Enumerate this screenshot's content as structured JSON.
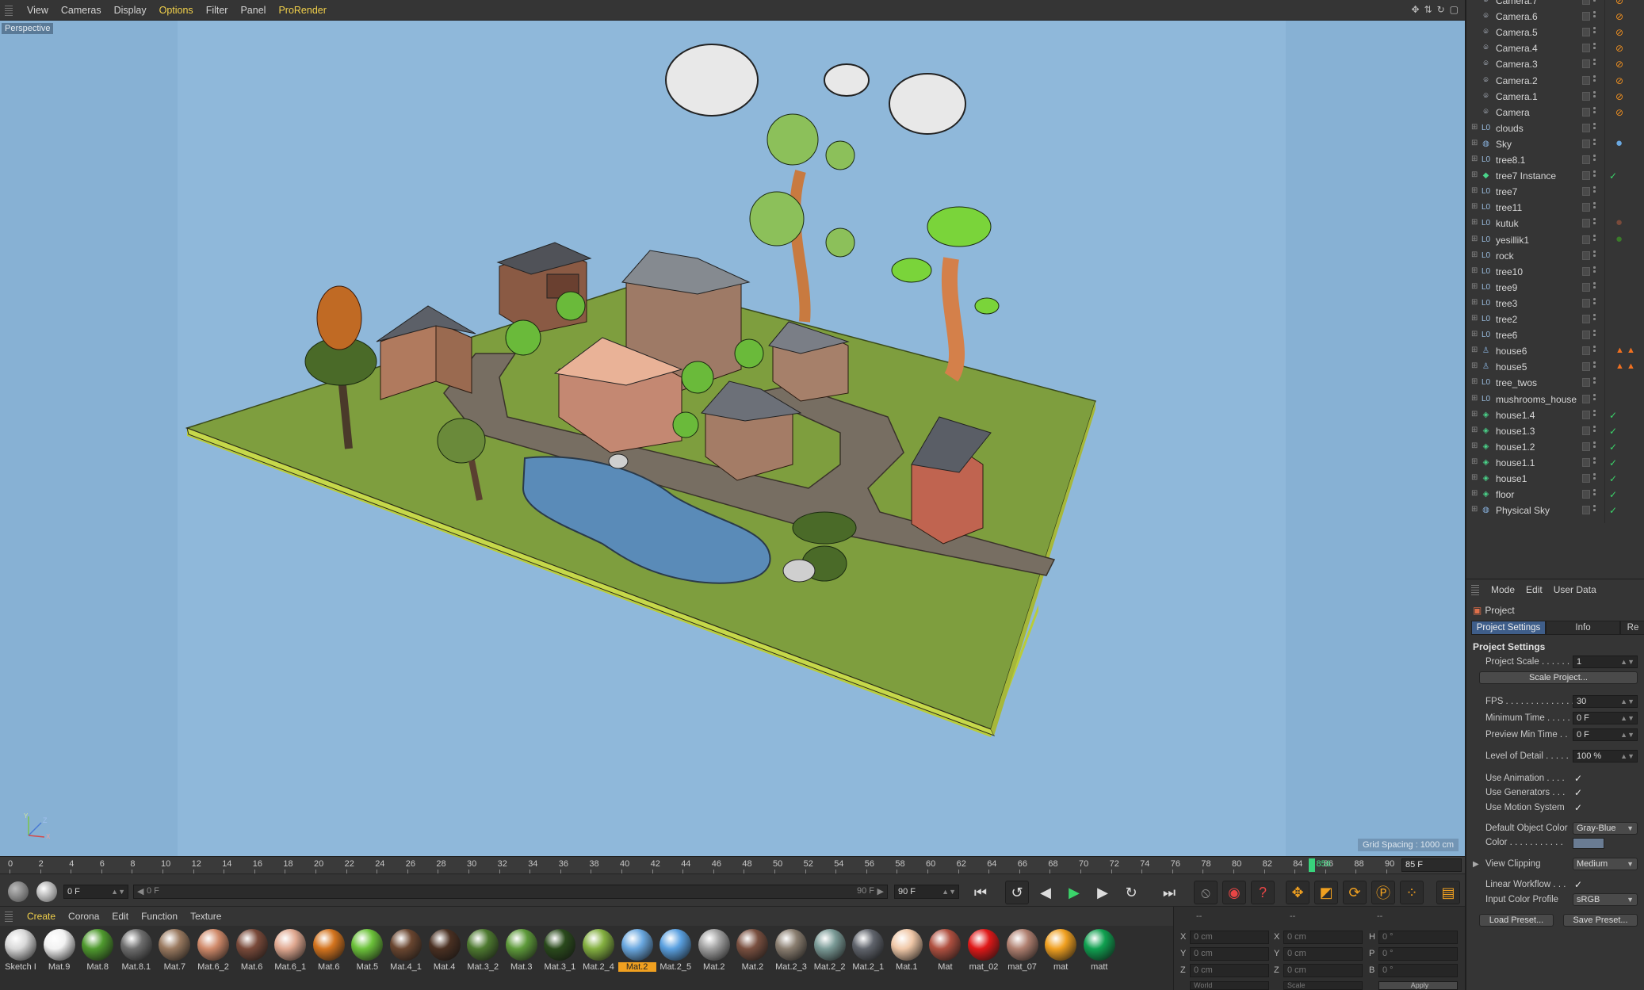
{
  "viewport": {
    "menu": [
      "View",
      "Cameras",
      "Display",
      "Options",
      "Filter",
      "Panel",
      "ProRender"
    ],
    "menu_highlight": [
      "Options",
      "ProRender"
    ],
    "label": "Perspective",
    "grid_spacing": "Grid Spacing : 1000 cm",
    "axis": {
      "y": "Y",
      "z": "Z",
      "x": "X"
    }
  },
  "timeline": {
    "ticks": [
      "0",
      "2",
      "4",
      "6",
      "8",
      "10",
      "12",
      "14",
      "16",
      "18",
      "20",
      "22",
      "24",
      "26",
      "28",
      "30",
      "32",
      "34",
      "36",
      "38",
      "40",
      "42",
      "44",
      "46",
      "48",
      "50",
      "52",
      "54",
      "56",
      "58",
      "60",
      "62",
      "64",
      "66",
      "68",
      "70",
      "72",
      "74",
      "76",
      "78",
      "80",
      "82",
      "84",
      "86",
      "88",
      "90"
    ],
    "current_label": "856",
    "end_field": "85 F"
  },
  "transport": {
    "current_frame": "0 F",
    "range_start": "0 F",
    "range_end": "90 F",
    "max_frame": "90 F"
  },
  "material_manager": {
    "menu": [
      "Create",
      "Corona",
      "Edit",
      "Function",
      "Texture"
    ],
    "active_menu": "Create",
    "materials": [
      {
        "name": "Sketch I",
        "color": "#d8d8d8"
      },
      {
        "name": "Mat.9",
        "color": "#f2f2f2"
      },
      {
        "name": "Mat.8",
        "color": "#4f9a2e"
      },
      {
        "name": "Mat.8.1",
        "color": "#6e6e6e"
      },
      {
        "name": "Mat.7",
        "color": "#9a7a60"
      },
      {
        "name": "Mat.6_2",
        "color": "#d08a6a"
      },
      {
        "name": "Mat.6",
        "color": "#7a4a3a"
      },
      {
        "name": "Mat.6_1",
        "color": "#e0a890"
      },
      {
        "name": "Mat.6",
        "color": "#d4741e"
      },
      {
        "name": "Mat.5",
        "color": "#6cc23a"
      },
      {
        "name": "Mat.4_1",
        "color": "#6a4630"
      },
      {
        "name": "Mat.4",
        "color": "#4a3022"
      },
      {
        "name": "Mat.3_2",
        "color": "#4e7a30"
      },
      {
        "name": "Mat.3",
        "color": "#5e9a3a"
      },
      {
        "name": "Mat.3_1",
        "color": "#2a4a1c"
      },
      {
        "name": "Mat.2_4",
        "color": "#84b040"
      },
      {
        "name": "Mat.2",
        "color": "#6aa8e0"
      },
      {
        "name": "Mat.2_5",
        "color": "#5aa0e0"
      },
      {
        "name": "Mat.2",
        "color": "#a0a0a0"
      },
      {
        "name": "Mat.2",
        "color": "#7a5040"
      },
      {
        "name": "Mat.2_3",
        "color": "#8a7e70"
      },
      {
        "name": "Mat.2_2",
        "color": "#7a9a96"
      },
      {
        "name": "Mat.2_1",
        "color": "#60646c"
      },
      {
        "name": "Mat.1",
        "color": "#f0c8a8"
      },
      {
        "name": "Mat",
        "color": "#b05040"
      },
      {
        "name": "mat_02",
        "color": "#e01818"
      },
      {
        "name": "mat_07",
        "color": "#b08070"
      },
      {
        "name": "mat",
        "color": "#f0a020"
      },
      {
        "name": "matt",
        "color": "#10a050"
      }
    ],
    "selected_index": 16
  },
  "coordinates": {
    "headers": [
      "--",
      "--",
      "--"
    ],
    "rows": [
      {
        "a": "X",
        "a_val": "0 cm",
        "b": "X",
        "b_val": "0 cm",
        "c": "H",
        "c_val": "0 °"
      },
      {
        "a": "Y",
        "a_val": "0 cm",
        "b": "Y",
        "b_val": "0 cm",
        "c": "P",
        "c_val": "0 °"
      },
      {
        "a": "Z",
        "a_val": "0 cm",
        "b": "Z",
        "b_val": "0 cm",
        "c": "B",
        "c_val": "0 °"
      }
    ],
    "world": "World",
    "scale": "Scale",
    "apply": "Apply"
  },
  "object_manager": {
    "objects": [
      {
        "name": "Camera.7",
        "icon": "camera",
        "tag": "no"
      },
      {
        "name": "Camera.6",
        "icon": "camera",
        "tag": "no"
      },
      {
        "name": "Camera.5",
        "icon": "camera",
        "tag": "no"
      },
      {
        "name": "Camera.4",
        "icon": "camera",
        "tag": "no"
      },
      {
        "name": "Camera.3",
        "icon": "camera",
        "tag": "no"
      },
      {
        "name": "Camera.2",
        "icon": "camera",
        "tag": "no"
      },
      {
        "name": "Camera.1",
        "icon": "camera",
        "tag": "no"
      },
      {
        "name": "Camera",
        "icon": "camera",
        "tag": "no"
      },
      {
        "name": "clouds",
        "icon": "null",
        "tag": ""
      },
      {
        "name": "Sky",
        "icon": "sky",
        "tag": "sphere"
      },
      {
        "name": "tree8.1",
        "icon": "null",
        "tag": ""
      },
      {
        "name": "tree7 Instance",
        "icon": "instance",
        "tag": "check"
      },
      {
        "name": "tree7",
        "icon": "null",
        "tag": ""
      },
      {
        "name": "tree11",
        "icon": "null",
        "tag": ""
      },
      {
        "name": "kutuk",
        "icon": "null",
        "tag": "brown"
      },
      {
        "name": "yesillik1",
        "icon": "null",
        "tag": "green"
      },
      {
        "name": "rock",
        "icon": "null",
        "tag": ""
      },
      {
        "name": "tree10",
        "icon": "null",
        "tag": ""
      },
      {
        "name": "tree9",
        "icon": "null",
        "tag": ""
      },
      {
        "name": "tree3",
        "icon": "null",
        "tag": ""
      },
      {
        "name": "tree2",
        "icon": "null",
        "tag": ""
      },
      {
        "name": "tree6",
        "icon": "null",
        "tag": ""
      },
      {
        "name": "house6",
        "icon": "figure",
        "tag": "warning"
      },
      {
        "name": "house5",
        "icon": "figure",
        "tag": "warning"
      },
      {
        "name": "tree_twos",
        "icon": "null",
        "tag": ""
      },
      {
        "name": "mushrooms_house",
        "icon": "null",
        "tag": ""
      },
      {
        "name": "house1.4",
        "icon": "poly",
        "tag": "check"
      },
      {
        "name": "house1.3",
        "icon": "poly",
        "tag": "check"
      },
      {
        "name": "house1.2",
        "icon": "poly",
        "tag": "check"
      },
      {
        "name": "house1.1",
        "icon": "poly",
        "tag": "check"
      },
      {
        "name": "house1",
        "icon": "poly",
        "tag": "check"
      },
      {
        "name": "floor",
        "icon": "poly",
        "tag": "check"
      },
      {
        "name": "Physical Sky",
        "icon": "sky",
        "tag": "check"
      }
    ]
  },
  "attribute_manager": {
    "menu": [
      "Mode",
      "Edit",
      "User Data"
    ],
    "object": "Project",
    "tabs": [
      "Project Settings",
      "Info",
      "Re"
    ],
    "section": "Project Settings",
    "project_scale_label": "Project Scale . . . . . .",
    "project_scale_value": "1",
    "scale_project_button": "Scale Project...",
    "fps_label": "FPS . . . . . . . . . . . . . .",
    "fps_value": "30",
    "min_time_label": "Minimum Time . . . . .",
    "min_time_value": "0 F",
    "preview_min_label": "Preview Min Time . .",
    "preview_min_value": "0 F",
    "lod_label": "Level of Detail . . . . .",
    "lod_value": "100 %",
    "use_animation": "Use Animation . . . .",
    "use_generators": "Use Generators . . .",
    "use_motion": "Use Motion System",
    "default_color_label": "Default Object Color",
    "default_color_value": "Gray-Blue",
    "color_label": "Color . . . . . . . . . . .",
    "view_clipping_label": "View Clipping",
    "view_clipping_value": "Medium",
    "linear_workflow": "Linear Workflow . . .",
    "input_profile_label": "Input Color Profile",
    "input_profile_value": "sRGB",
    "load_preset": "Load Preset...",
    "save_preset": "Save Preset..."
  }
}
